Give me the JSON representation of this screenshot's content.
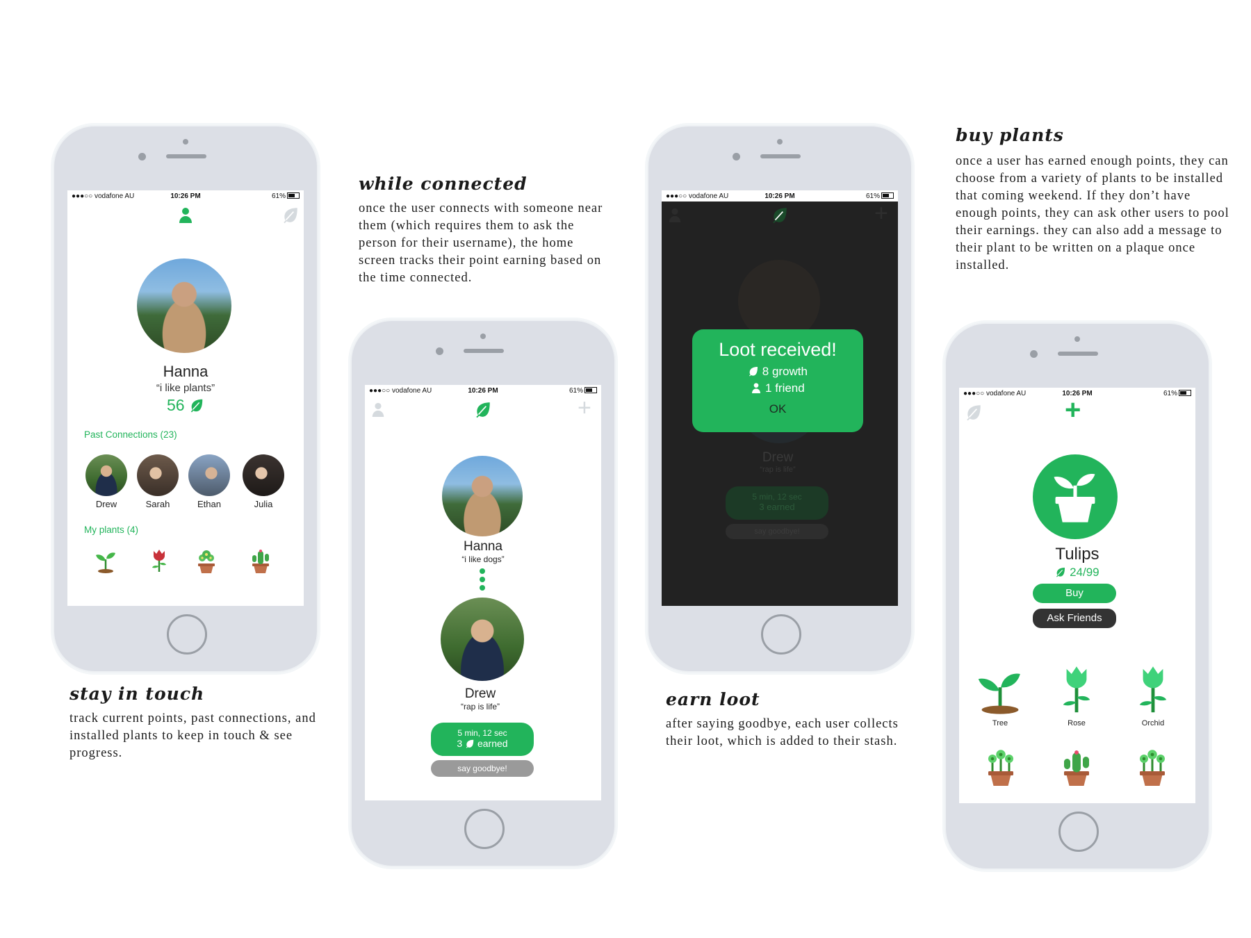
{
  "status": {
    "carrier": "●●●○○ vodafone AU",
    "time": "10:26 PM",
    "battery": "61%"
  },
  "colors": {
    "accent": "#22b45b",
    "frame": "#dcdfe6",
    "overlay": "#1e1e1e"
  },
  "screen1": {
    "name": "Hanna",
    "status": "“i like plants”",
    "points": "56",
    "past_connections": "Past Connections (23)",
    "friends": [
      "Drew",
      "Sarah",
      "Ethan",
      "Julia"
    ],
    "my_plants": "My plants (4)"
  },
  "screen2": {
    "user_name": "Hanna",
    "user_status": "“i like dogs”",
    "friend_name": "Drew",
    "friend_status": "“rap is life”",
    "timer": "5 min, 12 sec",
    "earned_num": "3",
    "earned_label": "earned",
    "goodbye": "say goodbye!"
  },
  "screen3": {
    "title": "Loot received!",
    "growth": "8 growth",
    "friend": "1 friend",
    "ok": "OK",
    "bg_name": "Drew",
    "bg_status": "“rap is life”",
    "bg_timer": "5 min, 12 sec",
    "bg_earned_num": "3",
    "bg_earned_label": "earned",
    "bg_goodbye": "say goodbye!"
  },
  "screen4": {
    "plant_name": "Tulips",
    "points": "24/99",
    "buy": "Buy",
    "ask": "Ask Friends",
    "plants": [
      "Tree",
      "Rose",
      "Orchid"
    ]
  },
  "captions": {
    "c1_title": "stay in touch",
    "c1_text": "track current points, past connections, and installed plants to keep in touch & see progress.",
    "c2_title": "while connected",
    "c2_text": "once the user connects with someone near them (which requires them to ask the person for their username), the home screen tracks their point earning based on the time connected.",
    "c3_title": "earn loot",
    "c3_text": "after saying goodbye, each user collects their loot, which is added to their stash.",
    "c4_title": "buy plants",
    "c4_text": "once a user has earned enough points, they can choose from a variety of plants to be installed that coming weekend. If they don’t have enough points, they can ask other users to pool their earnings. they can also add a message to their plant to be written on a plaque once installed."
  }
}
